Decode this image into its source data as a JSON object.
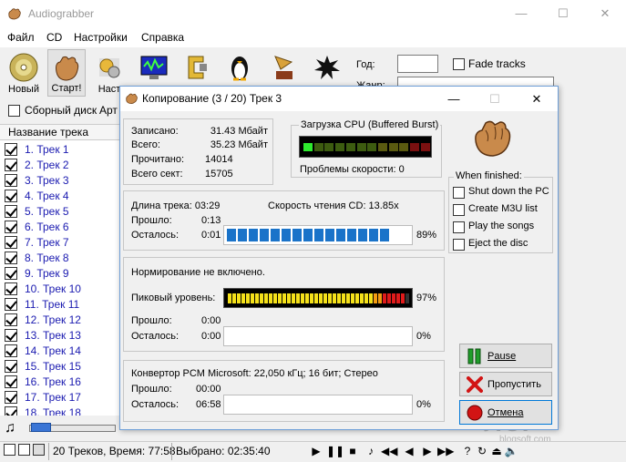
{
  "main_window": {
    "title": "Audiograbber",
    "controls": {
      "minimize": "—",
      "maximize": "☐",
      "close": "✕"
    },
    "menu": [
      "Файл",
      "CD",
      "Настройки",
      "Справка"
    ],
    "toolbar": [
      {
        "label": "Новый",
        "icon": "cd-disc-icon"
      },
      {
        "label": "Старт!",
        "icon": "grabbing-hand-icon"
      },
      {
        "label": "Наст",
        "icon": "settings-gear-icon"
      },
      {
        "label": "",
        "icon": "monitor-icon"
      },
      {
        "label": "",
        "icon": "clamp-icon"
      },
      {
        "label": "",
        "icon": "cddb-icon"
      },
      {
        "label": "",
        "icon": "linux-penguin-icon"
      },
      {
        "label": "",
        "icon": "gramophone-icon"
      },
      {
        "label": "",
        "icon": "splat-icon"
      }
    ],
    "year_label": "Год:",
    "year_value": "",
    "fade_tracks_label": "Fade tracks",
    "genre_label": "Жанр:",
    "genre_value": "",
    "compilation_label": "Сборный диск",
    "artist_label": "Арт",
    "track_header": "Название трека",
    "tracks": [
      "1. Трек  1",
      "2. Трек  2",
      "3. Трек  3",
      "4. Трек  4",
      "5. Трек  5",
      "6. Трек  6",
      "7. Трек  7",
      "8. Трек  8",
      "9. Трек  9",
      "10. Трек 10",
      "11. Трек 11",
      "12. Трек 12",
      "13. Трек 13",
      "14. Трек 14",
      "15. Трек 15",
      "16. Трек 16",
      "17. Трек 17",
      "18. Трек 18"
    ],
    "status": {
      "tracks": "20 Треков,  Время: 77:58",
      "selected": "Выбрано: 02:35:40"
    },
    "watermark": "ЛОГ",
    "watermark_url": "blogsoft.com"
  },
  "dialog": {
    "title": "Копирование  (3 / 20)  Трек  3",
    "controls": {
      "minimize": "—",
      "maximize": "☐",
      "close": "✕"
    },
    "stats": {
      "written_label": "Записано:",
      "written_value": "31.43 Мбайт",
      "total_label": "Всего:",
      "total_value": "35.23 Мбайт",
      "read_label": "Прочитано:",
      "read_value": "14014",
      "sectors_label": "Всего  сект:",
      "sectors_value": "15705"
    },
    "cpu": {
      "legend": "Загрузка CPU (Buffered Burst)",
      "level": 0.07,
      "speed_problems": "Проблемы скорости: 0"
    },
    "when_finished": {
      "legend": "When finished:",
      "options": [
        "Shut down the PC",
        "Create M3U list",
        "Play the songs",
        "Eject the disc"
      ]
    },
    "track_progress": {
      "length": "Длина трека: 03:29",
      "read_speed": "Скорость чтения CD: 13.85x",
      "elapsed_label": "Прошло:",
      "elapsed_value": "0:13",
      "remaining_label": "Осталось:",
      "remaining_value": "0:01",
      "percent": "89%",
      "fraction": 0.89
    },
    "normalization": {
      "status": "Нормирование не включено.",
      "peak_label": "Пиковый уровень:",
      "peak_percent": "97%",
      "peak_fraction": 0.97,
      "elapsed_label": "Прошло:",
      "elapsed_value": "0:00",
      "remaining_label": "Осталось:",
      "remaining_value": "0:00",
      "percent": "0%"
    },
    "converter": {
      "info": "Конвертор PCM Microsoft: 22,050 кГц; 16 бит; Стерео",
      "elapsed_label": "Прошло:",
      "elapsed_value": "00:00",
      "remaining_label": "Осталось:",
      "remaining_value": "06:58",
      "percent": "0%"
    },
    "buttons": {
      "pause": "Pause",
      "skip": "Пропустить",
      "cancel": "Отмена"
    }
  }
}
